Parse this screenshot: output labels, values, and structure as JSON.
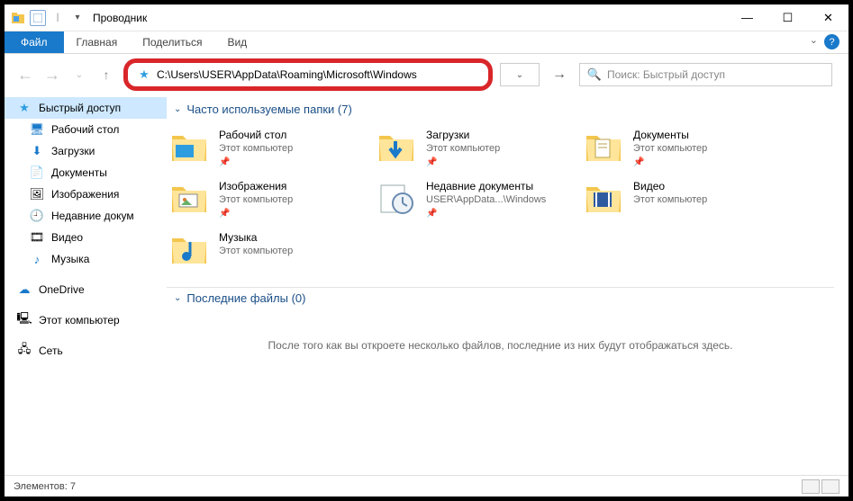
{
  "title": "Проводник",
  "ribbon": {
    "file": "Файл",
    "tabs": [
      "Главная",
      "Поделиться",
      "Вид"
    ]
  },
  "address": {
    "path": "C:\\Users\\USER\\AppData\\Roaming\\Microsoft\\Windows"
  },
  "search": {
    "placeholder": "Поиск: Быстрый доступ"
  },
  "sidebar": {
    "quick_access": "Быстрый доступ",
    "items": [
      {
        "label": "Рабочий стол"
      },
      {
        "label": "Загрузки"
      },
      {
        "label": "Документы"
      },
      {
        "label": "Изображения"
      },
      {
        "label": "Недавние докум"
      },
      {
        "label": "Видео"
      },
      {
        "label": "Музыка"
      }
    ],
    "onedrive": "OneDrive",
    "this_pc": "Этот компьютер",
    "network": "Сеть"
  },
  "sections": {
    "frequent": "Часто используемые папки (7)",
    "recent": "Последние файлы (0)"
  },
  "folders": [
    {
      "name": "Рабочий стол",
      "sub": "Этот компьютер",
      "pinned": true
    },
    {
      "name": "Загрузки",
      "sub": "Этот компьютер",
      "pinned": true
    },
    {
      "name": "Документы",
      "sub": "Этот компьютер",
      "pinned": true
    },
    {
      "name": "Изображения",
      "sub": "Этот компьютер",
      "pinned": true
    },
    {
      "name": "Недавние документы",
      "sub": "USER\\AppData...\\Windows",
      "pinned": true
    },
    {
      "name": "Видео",
      "sub": "Этот компьютер",
      "pinned": false
    },
    {
      "name": "Музыка",
      "sub": "Этот компьютер",
      "pinned": false
    }
  ],
  "empty_recent": "После того как вы откроете несколько файлов, последние из них будут отображаться здесь.",
  "status": {
    "count": "Элементов: 7"
  }
}
